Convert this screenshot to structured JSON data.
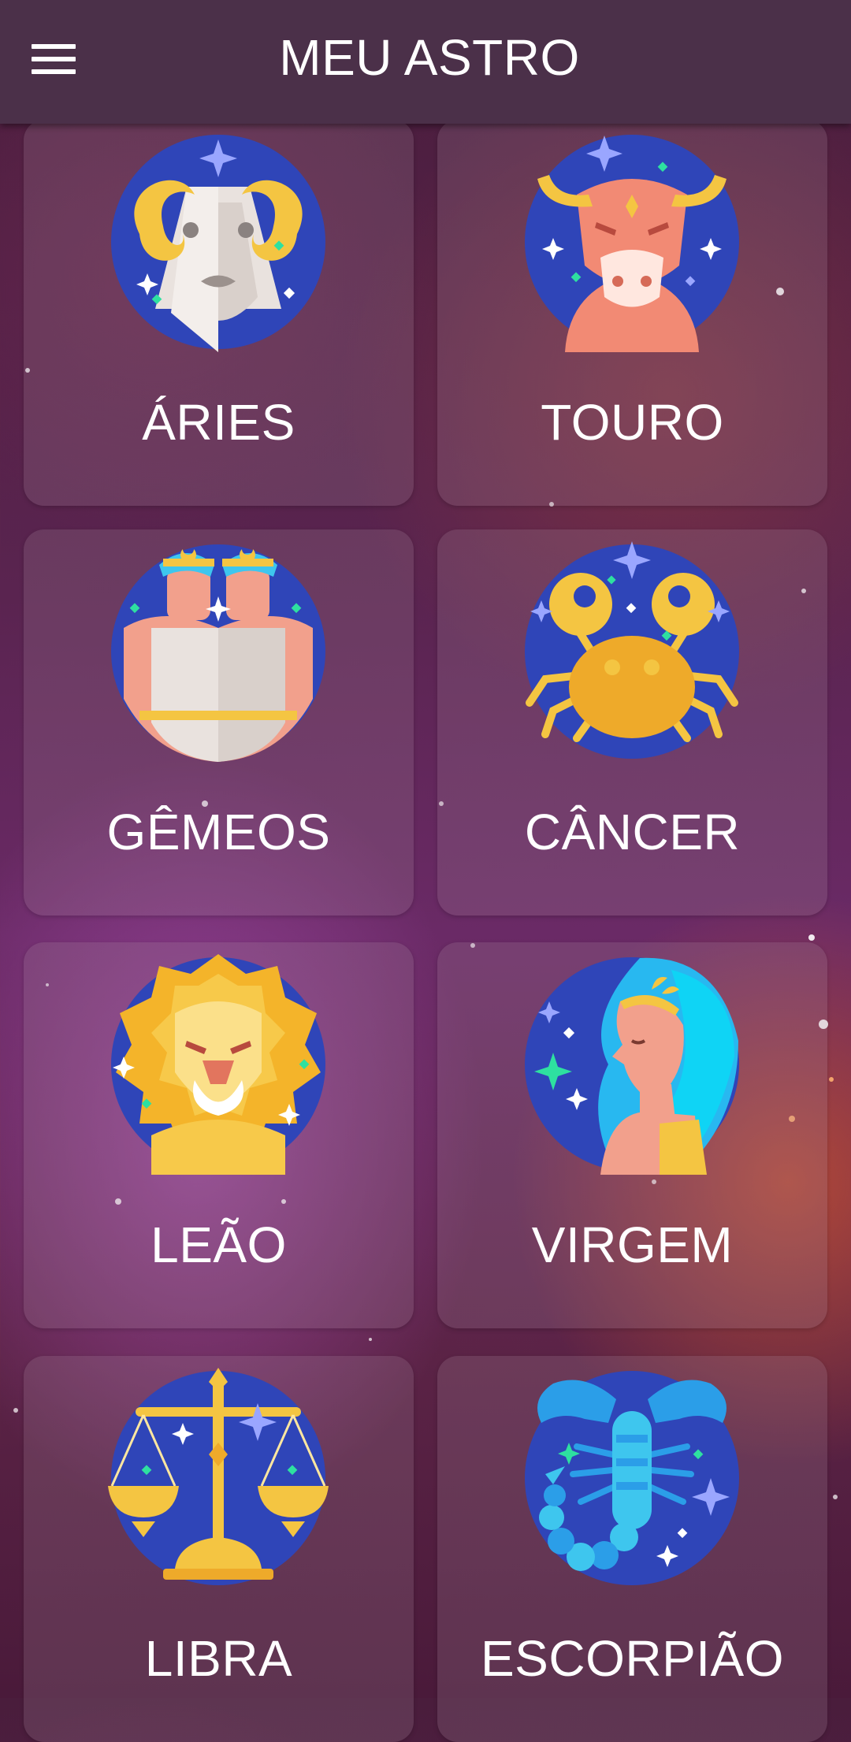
{
  "app": {
    "title": "MEU ASTRO",
    "menu_icon": "hamburger-menu-icon"
  },
  "signs": [
    {
      "name": "ÁRIES",
      "icon": "aries-ram-icon"
    },
    {
      "name": "TOURO",
      "icon": "taurus-bull-icon"
    },
    {
      "name": "GÊMEOS",
      "icon": "gemini-twins-icon"
    },
    {
      "name": "CÂNCER",
      "icon": "cancer-crab-icon"
    },
    {
      "name": "LEÃO",
      "icon": "leo-lion-icon"
    },
    {
      "name": "VIRGEM",
      "icon": "virgo-maiden-icon"
    },
    {
      "name": "LIBRA",
      "icon": "libra-scales-icon"
    },
    {
      "name": "ESCORPIÃO",
      "icon": "scorpio-scorpion-icon"
    }
  ],
  "colors": {
    "appbar": "#4b3049",
    "icon_circle": "#2f45b8",
    "gold": "#f4c542",
    "text": "#ffffff"
  }
}
